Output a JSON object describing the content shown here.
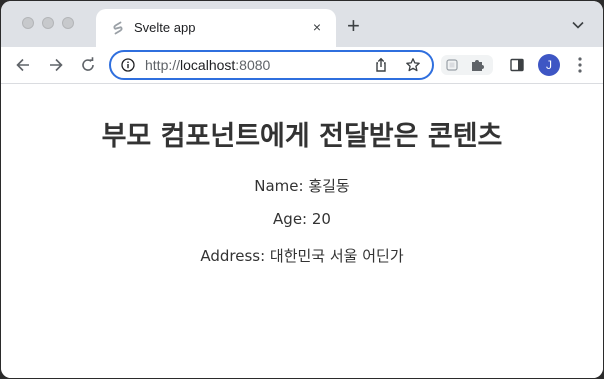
{
  "browser": {
    "tab_title": "Svelte app",
    "tab_close": "×",
    "new_tab": "+",
    "url_scheme": "http://",
    "url_host": "localhost",
    "url_port": ":8080",
    "profile_initial": "J"
  },
  "page": {
    "heading": "부모 컴포넌트에게 전달받은 콘텐츠",
    "name_label": "Name: 홍길동",
    "age_label": "Age: 20",
    "address_label": "Address: 대한민국 서울 어딘가"
  },
  "colors": {
    "tabstrip": "#dee1e6",
    "omnibox_focus": "#2f6fde",
    "avatar": "#3e56c4",
    "text": "#333333"
  },
  "icons": [
    "svelte-favicon",
    "close-icon",
    "plus-icon",
    "chevron-down-icon",
    "back-icon",
    "forward-icon",
    "reload-icon",
    "info-icon",
    "share-icon",
    "star-icon",
    "extension-icon",
    "puzzle-icon",
    "side-panel-icon",
    "kebab-menu-icon"
  ]
}
